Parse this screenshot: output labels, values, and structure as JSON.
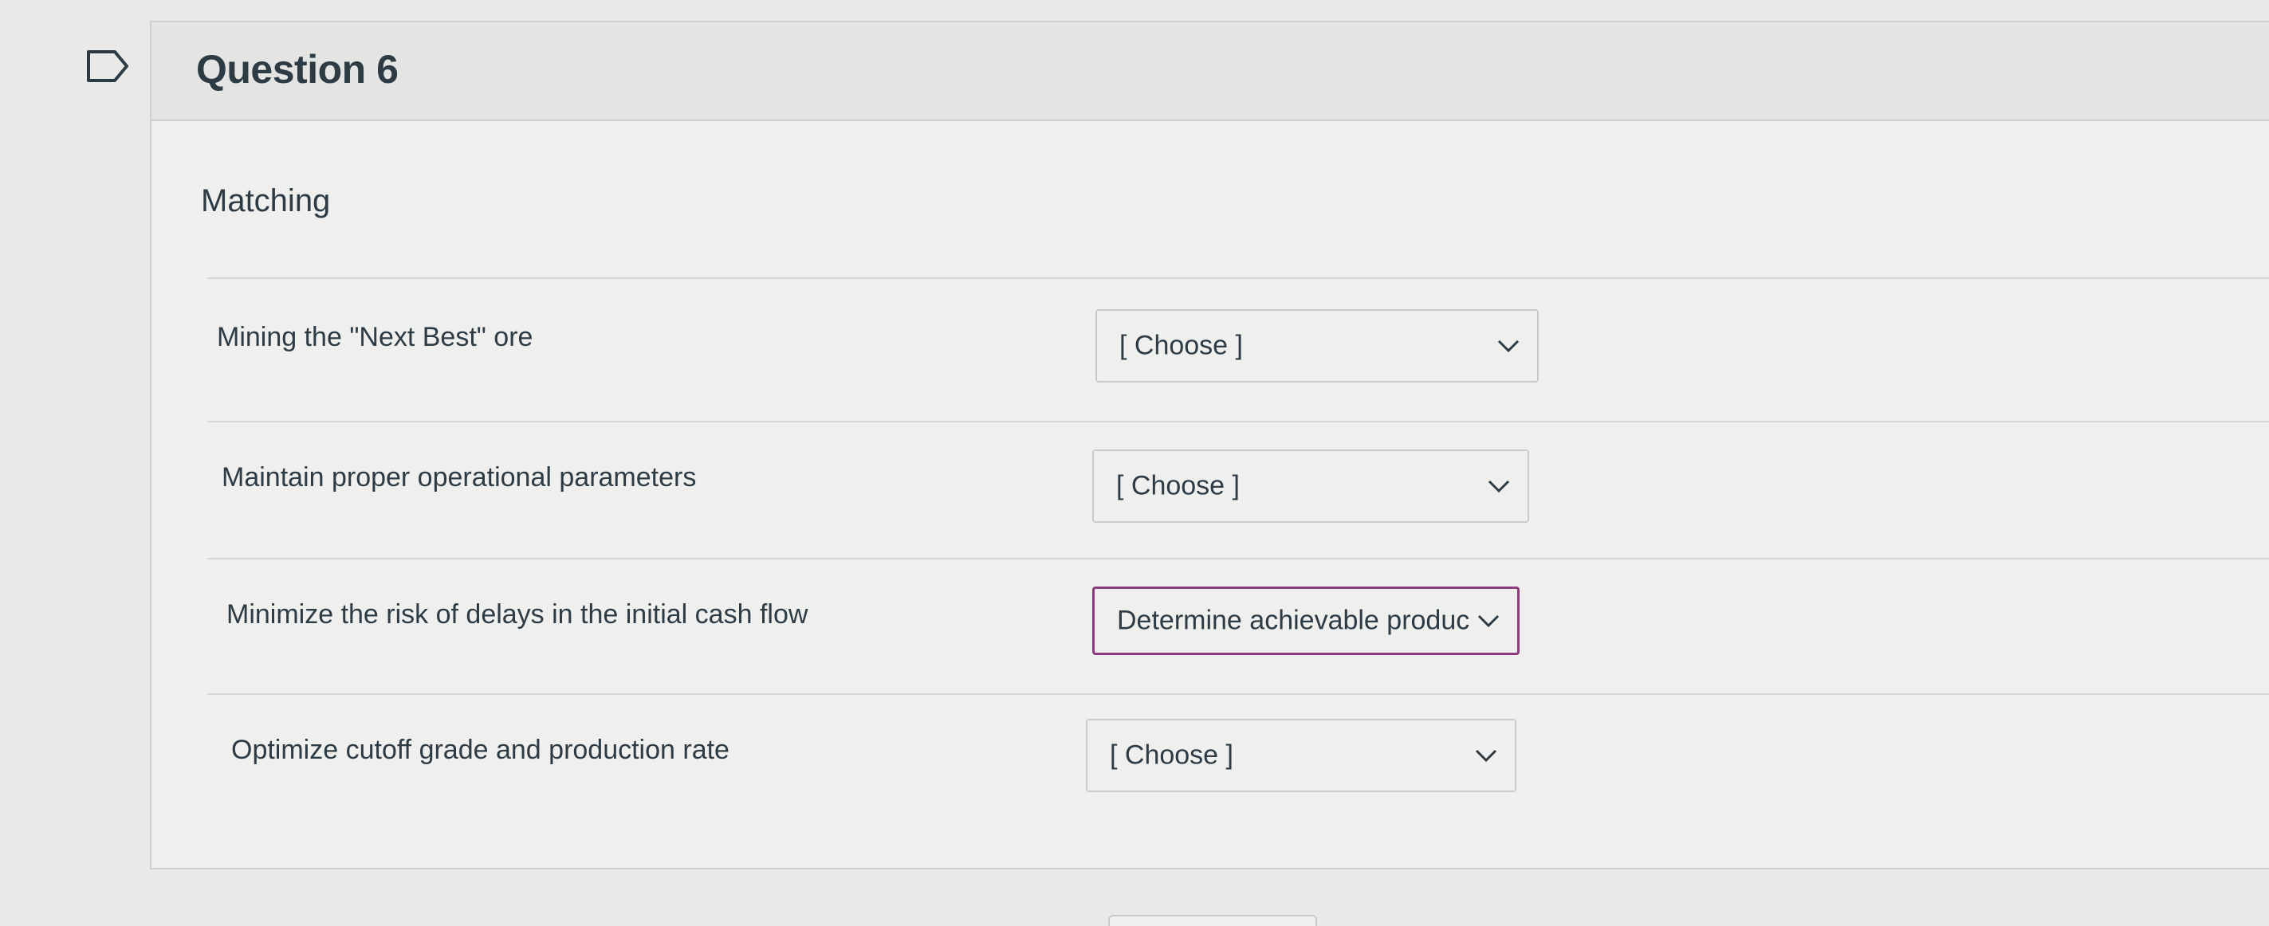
{
  "question": {
    "title": "Question 6",
    "type_label": "Matching",
    "flag_icon": "bookmark-icon"
  },
  "rows": [
    {
      "prompt": "Mining the \"Next Best\" ore",
      "selected": "[ Choose ]"
    },
    {
      "prompt": "Maintain proper operational parameters",
      "selected": "[ Choose ]"
    },
    {
      "prompt": "Minimize the risk of delays in the initial cash flow",
      "selected": "Determine achievable produc"
    },
    {
      "prompt": "Optimize cutoff grade and production rate",
      "selected": "[ Choose ]"
    }
  ],
  "colors": {
    "text": "#2d3b45",
    "focus_border": "#8e3a7e",
    "header_bg": "#e4e4e2"
  }
}
